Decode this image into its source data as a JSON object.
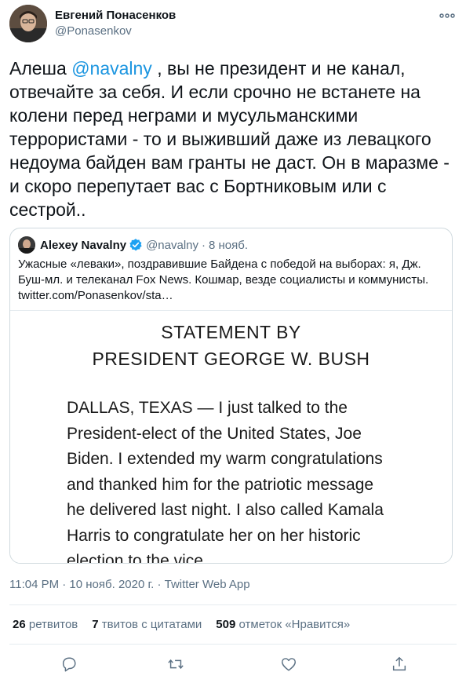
{
  "author": {
    "display_name": "Евгений Понасенков",
    "handle": "@Ponasenkov"
  },
  "tweet": {
    "text_before": "Алеша ",
    "mention": "@navalny",
    "text_after": " , вы не президент и не канал, отвечайте за себя. И если срочно не встанете на колени перед неграми и мусульманскими террористами - то и выживший даже из левацкого недоума байден вам гранты не даст. Он в маразме - и скоро перепутает вас с Бортниковым или с сестрой.."
  },
  "quoted": {
    "name": "Alexey Navalny",
    "handle": "@navalny",
    "separator": "·",
    "date": "8 нояб.",
    "text": "Ужасные «леваки», поздравившие Байдена с победой на выборах: я, Дж. Буш-мл. и телеканал Fox News. Кошмар, везде социалисты и коммунисты. twitter.com/Ponasenkov/sta…",
    "image": {
      "title_line1": "STATEMENT BY",
      "title_line2": "PRESIDENT GEORGE W. BUSH",
      "body": "DALLAS, TEXAS — I just talked to the President-elect of the United States, Joe Biden. I extended my warm congratulations and thanked him for the patriotic message he delivered last night. I also called Kamala Harris to congratulate her on her historic election to the vice"
    }
  },
  "meta": {
    "timestamp": "11:04 PM · 10 нояб. 2020 г. · Twitter Web App"
  },
  "stats": {
    "retweets_count": "26",
    "retweets_label": "ретвитов",
    "quotes_count": "7",
    "quotes_label": "твитов с цитатами",
    "likes_count": "509",
    "likes_label": "отметок «Нравится»"
  },
  "icons": {
    "more": "more-icon",
    "verified": "verified-icon",
    "reply": "reply-icon",
    "retweet": "retweet-icon",
    "like": "like-icon",
    "share": "share-icon"
  },
  "colors": {
    "link": "#1b95e0",
    "secondary_text": "#5b7083",
    "verified": "#1da1f2",
    "border": "#cfd9de"
  }
}
